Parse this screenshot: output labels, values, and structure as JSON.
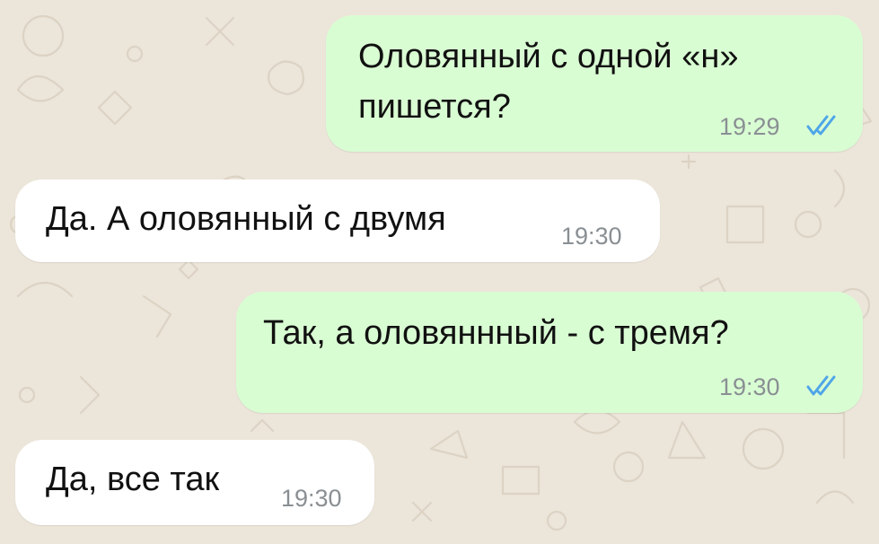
{
  "chat": {
    "messages": [
      {
        "direction": "outgoing",
        "text_lines": [
          "Оловянный с одной «н»",
          "пишется?"
        ],
        "time": "19:29",
        "status": "read-double-check"
      },
      {
        "direction": "incoming",
        "text": "Да. А оловянный с двумя",
        "time": "19:30"
      },
      {
        "direction": "outgoing",
        "text": "Так, а оловяннный - с тремя?",
        "time": "19:30",
        "status": "read-double-check"
      },
      {
        "direction": "incoming",
        "text": "Да, все так",
        "time": "19:30"
      }
    ]
  },
  "colors": {
    "wallpaper": "#ECE5DA",
    "outgoing_bubble": "#D9FDD3",
    "incoming_bubble": "#FFFFFF",
    "read_ticks": "#4FA6E8",
    "timestamp": "#8A8F93"
  },
  "icons": {
    "read_receipt": "double-check-icon",
    "wallpaper_pattern": "doodle-pattern"
  }
}
